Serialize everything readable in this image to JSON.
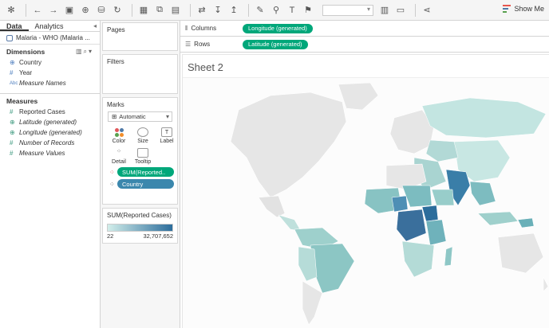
{
  "toolbar": {
    "show_me_label": "Show Me",
    "icons": [
      "back-icon",
      "forward-icon",
      "save-icon",
      "new-datasource-icon",
      "datasource-icon",
      "refresh-icon",
      "new-sheet-icon",
      "duplicate-icon",
      "clear-icon",
      "swap-icon",
      "sort-asc-icon",
      "sort-desc-icon",
      "highlight-icon",
      "paperclip-icon",
      "label-icon",
      "pin-icon",
      "fit-icon",
      "presentation-icon",
      "share-icon"
    ]
  },
  "data_pane": {
    "tabs": [
      "Data",
      "Analytics"
    ],
    "datasource_label": "Malaria - WHO (Malaria ...",
    "dimensions_title": "Dimensions",
    "dimensions": [
      {
        "label": "Country",
        "icon": "globe-icon"
      },
      {
        "label": "Year",
        "icon": "hash-icon"
      },
      {
        "label": "Measure Names",
        "icon": "abc-icon"
      }
    ],
    "measures_title": "Measures",
    "measures": [
      {
        "label": "Reported Cases",
        "icon": "hash-icon"
      },
      {
        "label": "Latitude (generated)",
        "icon": "globe-icon"
      },
      {
        "label": "Longitude (generated)",
        "icon": "globe-icon"
      },
      {
        "label": "Number of Records",
        "icon": "hash-icon"
      },
      {
        "label": "Measure Values",
        "icon": "hash-icon"
      }
    ]
  },
  "cards": {
    "pages_title": "Pages",
    "filters_title": "Filters",
    "marks_title": "Marks",
    "mark_type": "Automatic",
    "mark_buttons": [
      "Color",
      "Size",
      "Label",
      "Detail",
      "Tooltip"
    ],
    "color_pill": "SUM(Reported..",
    "detail_pill": "Country",
    "legend_title": "SUM(Reported Cases)",
    "legend_min": "22",
    "legend_max": "32,707,652",
    "legend_color_low": "#d2eeea",
    "legend_color_high": "#2c6d9c"
  },
  "shelves": {
    "columns_label": "Columns",
    "columns_pill": "Longitude (generated)",
    "rows_label": "Rows",
    "rows_pill": "Latitude (generated)"
  },
  "sheet": {
    "title": "Sheet 2"
  }
}
